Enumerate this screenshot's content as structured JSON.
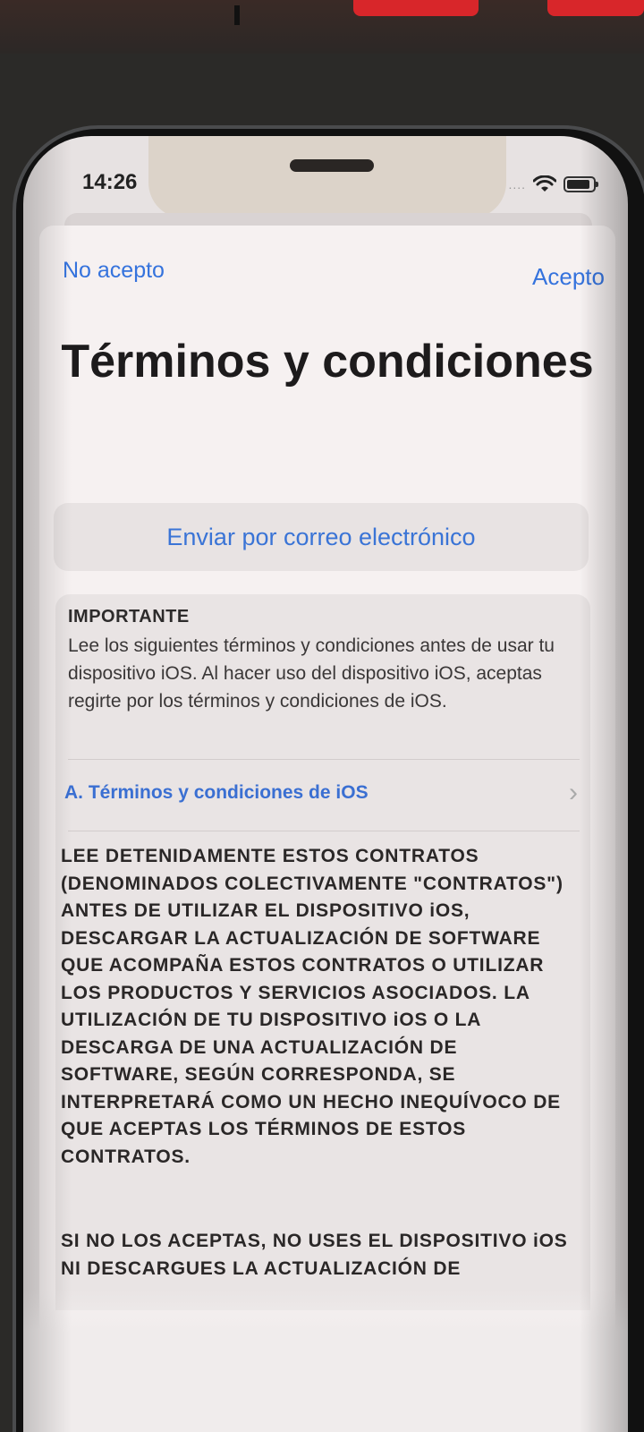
{
  "status_bar": {
    "time": "14:26",
    "dots": "....",
    "icons": [
      "wifi-icon",
      "battery-icon"
    ]
  },
  "nav": {
    "decline_label": "No acepto",
    "accept_label": "Acepto"
  },
  "title": "Términos y condiciones",
  "email_button_label": "Enviar por correo electrónico",
  "important": {
    "heading": "IMPORTANTE",
    "body": "Lee los siguientes términos y condiciones antes de usar tu dispositivo iOS. Al hacer uso del dispositivo iOS, aceptas regirte por los términos y condiciones de iOS."
  },
  "section": {
    "label": "A. Términos y condiciones de iOS"
  },
  "legal": {
    "paragraph_1": "LEE DETENIDAMENTE ESTOS CONTRATOS (DENOMINADOS COLECTIVAMENTE \"CONTRATOS\") ANTES DE UTILIZAR EL DISPOSITIVO iOS, DESCARGAR LA ACTUALIZACIÓN DE SOFTWARE QUE ACOMPAÑA ESTOS CONTRATOS O UTILIZAR LOS PRODUCTOS Y SERVICIOS ASOCIADOS. LA UTILIZACIÓN DE TU DISPOSITIVO iOS O LA DESCARGA DE UNA ACTUALIZACIÓN DE SOFTWARE, SEGÚN CORRESPONDA, SE INTERPRETARÁ COMO UN HECHO INEQUÍVOCO DE QUE ACEPTAS LOS TÉRMINOS DE ESTOS CONTRATOS.",
    "paragraph_2": "SI NO LOS ACEPTAS, NO USES EL DISPOSITIVO iOS NI DESCARGUES LA ACTUALIZACIÓN DE"
  },
  "colors": {
    "accent": "#3573dd",
    "sheet": "#f6f1f1",
    "card": "#e9e4e4"
  }
}
